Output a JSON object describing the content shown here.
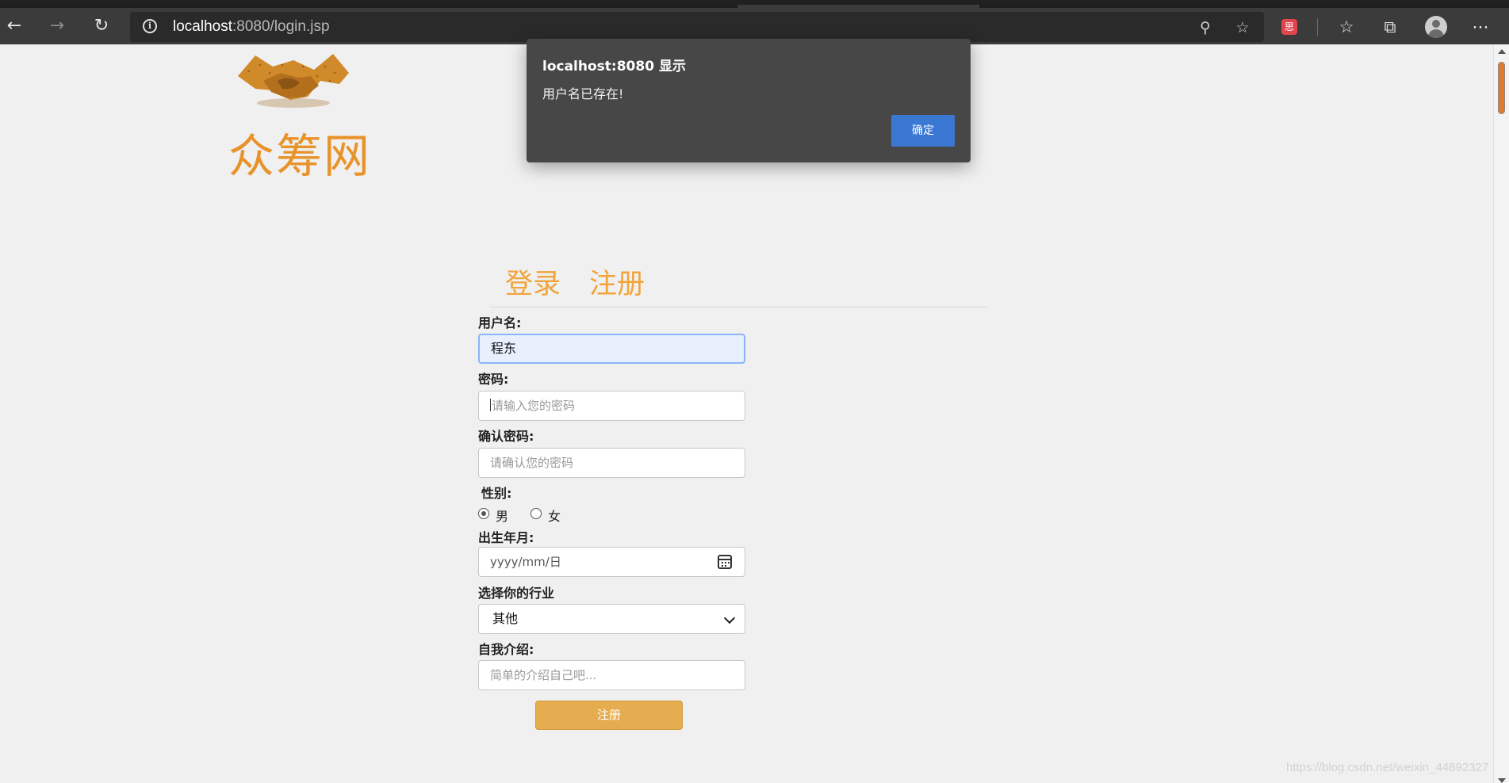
{
  "browser": {
    "url_host": "localhost",
    "url_rest": ":8080/login.jsp",
    "icons": [
      "back-arrow-icon",
      "forward-arrow-icon",
      "refresh-icon",
      "info-icon",
      "zoom-out-icon",
      "add-favorite-icon",
      "extension-icon",
      "favorites-icon",
      "collections-icon",
      "profile-icon",
      "more-icon"
    ],
    "extension_glyph": "思"
  },
  "site": {
    "title": "众筹网",
    "brand_color": "#e8932a"
  },
  "tabs": {
    "login": "登录",
    "register": "注册"
  },
  "form": {
    "username_label": "用户名:",
    "username_value": "程东",
    "password_label": "密码:",
    "password_placeholder": "请输入您的密码",
    "confirm_label": "确认密码:",
    "confirm_placeholder": "请确认您的密码",
    "gender_label": "性别:",
    "gender_male": "男",
    "gender_female": "女",
    "gender_selected": "男",
    "birth_label": "出生年月:",
    "birth_placeholder": "yyyy/mm/日",
    "industry_label": "选择你的行业",
    "industry_selected": "其他",
    "intro_label": "自我介绍:",
    "intro_placeholder": "简单的介绍自己吧...",
    "submit_label": "注册",
    "submit_color": "#e5ad4f"
  },
  "dialog": {
    "title": "localhost:8080 显示",
    "message": "用户名已存在!",
    "ok_label": "确定",
    "ok_color": "#3a78d4"
  },
  "watermark": "https://blog.csdn.net/weixin_44892327"
}
